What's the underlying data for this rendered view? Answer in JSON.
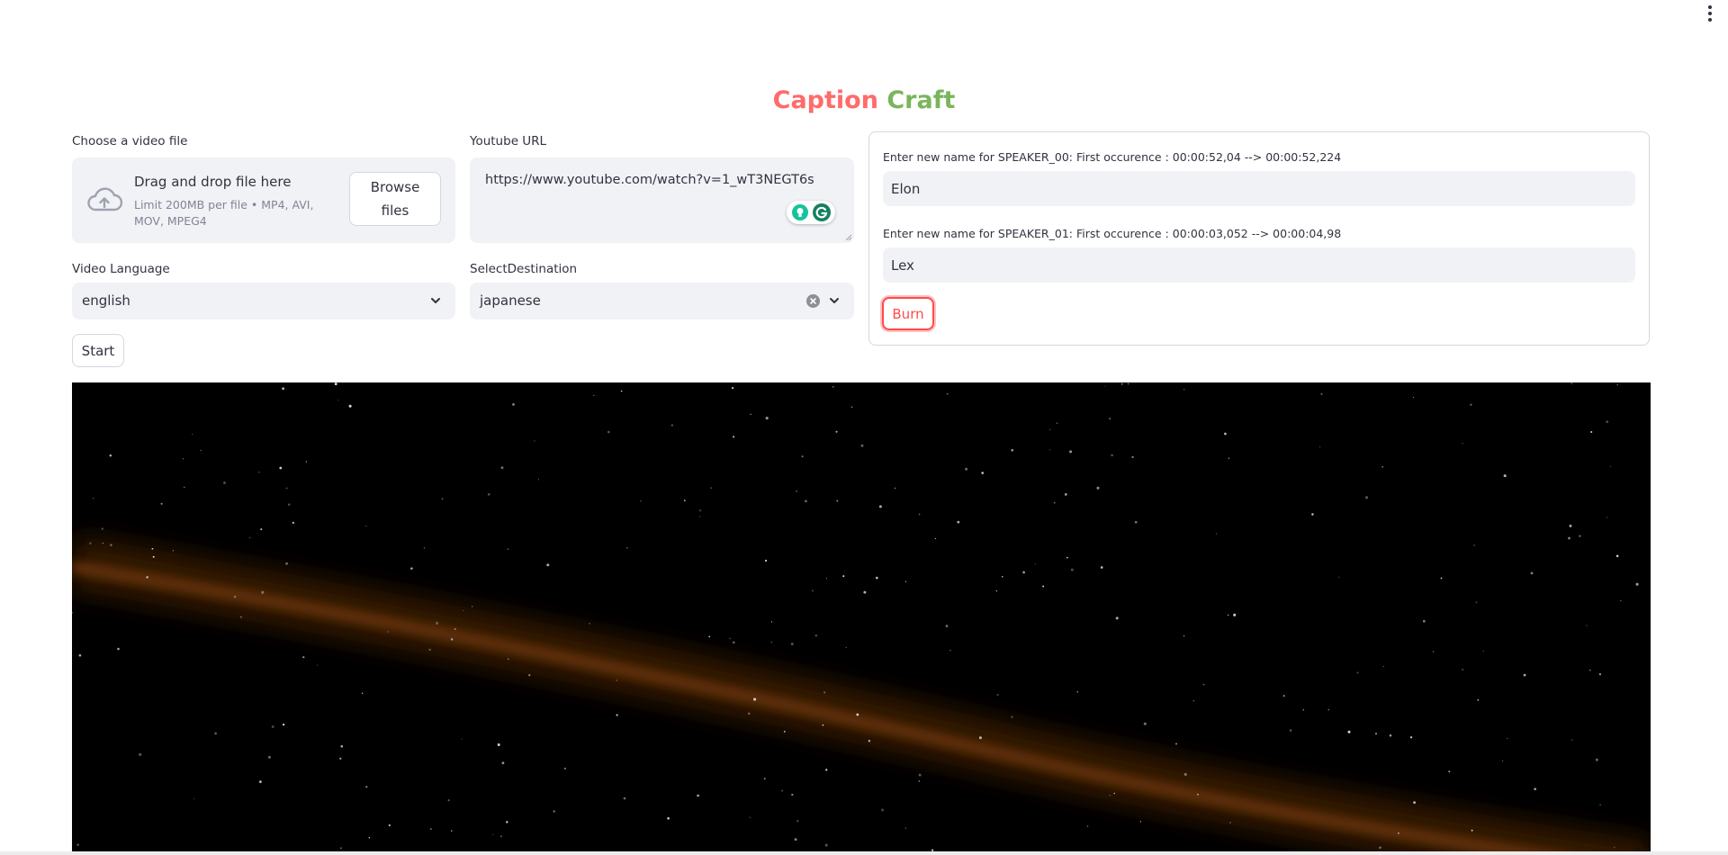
{
  "app": {
    "title_part1": "Caption",
    "title_part2": "Craft"
  },
  "colors": {
    "title_part1": "#ff6b6b",
    "title_part2": "#7ab55c",
    "accent": "#ff4b4b",
    "input_bg": "#f0f2f6",
    "video_bg": "#000000"
  },
  "uploader": {
    "label": "Choose a video file",
    "drop_text": "Drag and drop file here",
    "limit_text": "Limit 200MB per file • MP4, AVI, MOV, MPEG4",
    "browse_label": "Browse files",
    "icon": "cloud-upload-icon"
  },
  "youtube": {
    "label": "Youtube URL",
    "value": "https://www.youtube.com/watch?v=1_wT3NEGT6s"
  },
  "video_language": {
    "label": "Video Language",
    "selected": "english"
  },
  "destination": {
    "label": "SelectDestination",
    "selected": "japanese"
  },
  "start_button": "Start",
  "speakers": {
    "items": [
      {
        "label": "Enter new name for SPEAKER_00: First occurence : 00:00:52,04 --> 00:00:52,224",
        "value": "Elon"
      },
      {
        "label": "Enter new name for SPEAKER_01: First occurence : 00:00:03,052 --> 00:00:04,98",
        "value": "Lex"
      }
    ],
    "burn_label": "Burn"
  }
}
